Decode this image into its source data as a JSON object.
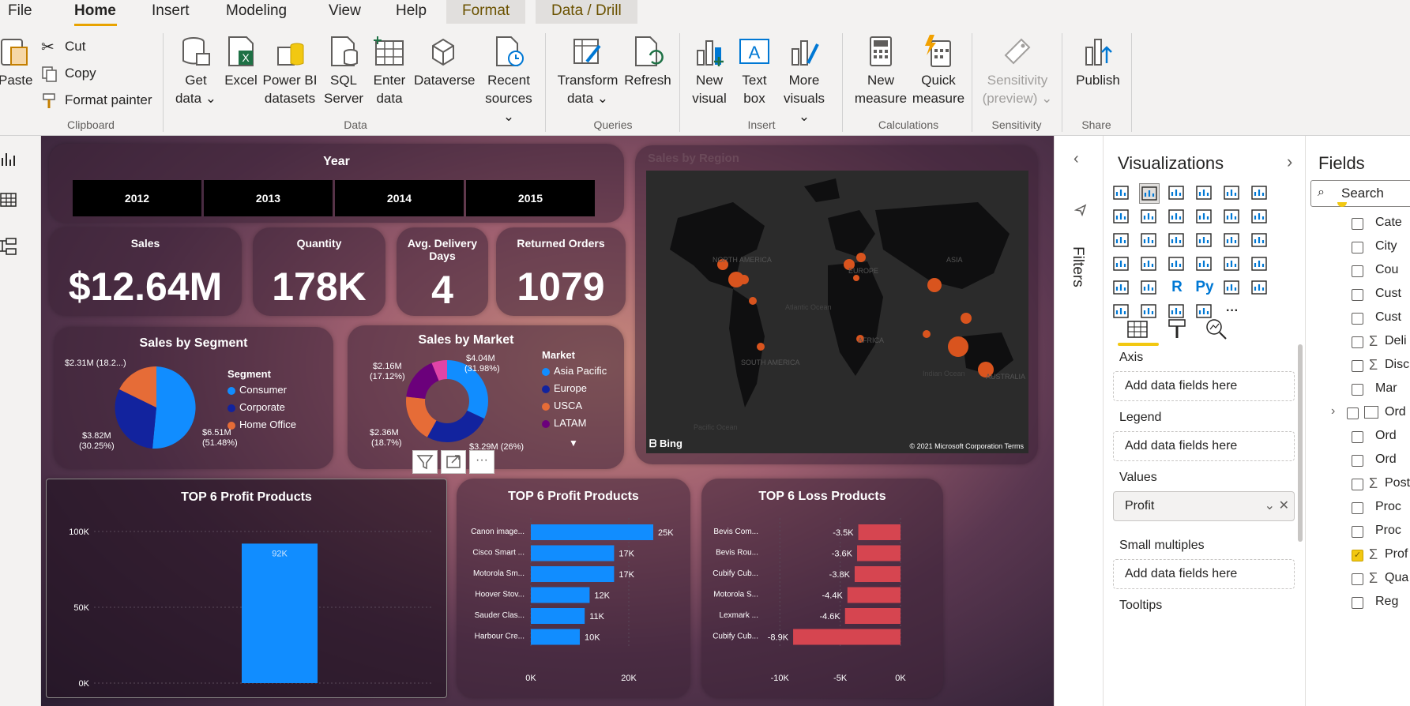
{
  "menu": {
    "file": "File",
    "home": "Home",
    "insert": "Insert",
    "modeling": "Modeling",
    "view": "View",
    "help": "Help",
    "format": "Format",
    "data_drill": "Data / Drill"
  },
  "ribbon": {
    "paste": "Paste",
    "cut": "Cut",
    "copy": "Copy",
    "format_painter": "Format painter",
    "clipboard": "Clipboard",
    "get_data_1": "Get",
    "get_data_2": "data ⌄",
    "excel": "Excel",
    "pbi_1": "Power BI",
    "pbi_2": "datasets",
    "sql_1": "SQL",
    "sql_2": "Server",
    "enter_1": "Enter",
    "enter_2": "data",
    "dataverse": "Dataverse",
    "recent_1": "Recent",
    "recent_2": "sources ⌄",
    "data_group": "Data",
    "transform_1": "Transform",
    "transform_2": "data ⌄",
    "refresh": "Refresh",
    "queries": "Queries",
    "new_visual_1": "New",
    "new_visual_2": "visual",
    "text_box_1": "Text",
    "text_box_2": "box",
    "more_visuals_1": "More",
    "more_visuals_2": "visuals ⌄",
    "insert_group": "Insert",
    "new_measure_1": "New",
    "new_measure_2": "measure",
    "quick_measure_1": "Quick",
    "quick_measure_2": "measure",
    "calculations": "Calculations",
    "sensitivity_1": "Sensitivity",
    "sensitivity_2": "(preview) ⌄",
    "sensitivity_group": "Sensitivity",
    "publish": "Publish",
    "share": "Share"
  },
  "dashboard": {
    "year_title": "Year",
    "years": [
      "2012",
      "2013",
      "2014",
      "2015"
    ],
    "kpis": {
      "sales_label": "Sales",
      "sales_value": "$12.64M",
      "quantity_label": "Quantity",
      "quantity_value": "178K",
      "delivery_label_1": "Avg. Delivery",
      "delivery_label_2": "Days",
      "delivery_value": "4",
      "returned_label": "Returned Orders",
      "returned_value": "1079"
    },
    "map": {
      "title": "Sales by Region",
      "bing": "Bing",
      "copyright": "© 2021 Microsoft Corporation  Terms",
      "labels": [
        "NORTH AMERICA",
        "EUROPE",
        "ASIA",
        "AFRICA",
        "SOUTH AMERICA",
        "AUSTRALIA",
        "Atlantic Ocean",
        "Indian Ocean",
        "Pacific Ocean"
      ]
    },
    "segment": {
      "title": "Sales by Segment",
      "legend_title": "Segment",
      "items": [
        {
          "name": "Consumer",
          "color": "#118dff"
        },
        {
          "name": "Corporate",
          "color": "#12239e"
        },
        {
          "name": "Home Office",
          "color": "#e66c37"
        }
      ],
      "label_top": "$2.31M (18.2...)",
      "label_left_1": "$3.82M",
      "label_left_2": "(30.25%)",
      "label_right_1": "$6.51M",
      "label_right_2": "(51.48%)"
    },
    "market": {
      "title": "Sales by Market",
      "legend_title": "Market",
      "items": [
        {
          "name": "Asia Pacific",
          "color": "#118dff"
        },
        {
          "name": "Europe",
          "color": "#12239e"
        },
        {
          "name": "USCA",
          "color": "#e66c37"
        },
        {
          "name": "LATAM",
          "color": "#6b007b"
        }
      ],
      "label_tl_1": "$2.16M",
      "label_tl_2": "(17.12%)",
      "label_tr_1": "$4.04M",
      "label_tr_2": "(31.98%)",
      "label_bl_1": "$2.36M",
      "label_bl_2": "(18.7%)",
      "label_br": "$3.29M (26%)"
    }
  },
  "chart_data": [
    {
      "type": "bar",
      "title": "TOP 6 Profit Products",
      "categories": [
        ""
      ],
      "values": [
        92
      ],
      "value_labels": [
        "92K"
      ],
      "yticks": [
        "0K",
        "50K",
        "100K"
      ],
      "ylim": [
        0,
        100
      ]
    },
    {
      "type": "bar",
      "orientation": "horizontal",
      "title": "TOP 6 Profit Products",
      "categories": [
        "Canon image...",
        "Cisco Smart ...",
        "Motorola Sm...",
        "Hoover Stov...",
        "Sauder Clas...",
        "Harbour Cre..."
      ],
      "values": [
        25,
        17,
        17,
        12,
        11,
        10
      ],
      "value_labels": [
        "25K",
        "17K",
        "17K",
        "12K",
        "11K",
        "10K"
      ],
      "xticks": [
        "0K",
        "20K"
      ],
      "xlim": [
        0,
        30
      ]
    },
    {
      "type": "bar",
      "orientation": "horizontal",
      "title": "TOP 6 Loss Products",
      "categories": [
        "Bevis Com...",
        "Bevis Rou...",
        "Cubify Cub...",
        "Motorola S...",
        "Lexmark ...",
        "Cubify Cub..."
      ],
      "values": [
        -3.5,
        -3.6,
        -3.8,
        -4.4,
        -4.6,
        -8.9
      ],
      "value_labels": [
        "-3.5K",
        "-3.6K",
        "-3.8K",
        "-4.4K",
        "-4.6K",
        "-8.9K"
      ],
      "xticks": [
        "-10K",
        "-5K",
        "0K"
      ],
      "xlim": [
        -11,
        0
      ]
    }
  ],
  "visualizations": {
    "title": "Visualizations",
    "filters": "Filters",
    "wells": {
      "axis": "Axis",
      "legend": "Legend",
      "values": "Values",
      "small_multiples": "Small multiples",
      "tooltips": "Tooltips",
      "placeholder": "Add data fields here",
      "values_field": "Profit"
    },
    "r_icon": "R",
    "py_icon": "Py",
    "more": "···"
  },
  "fields": {
    "title": "Fields",
    "search_placeholder": "Search",
    "items": [
      {
        "name": "Cate",
        "sigma": false,
        "checked": false
      },
      {
        "name": "City",
        "sigma": false,
        "checked": false
      },
      {
        "name": "Cou",
        "sigma": false,
        "checked": false
      },
      {
        "name": "Cust",
        "sigma": false,
        "checked": false
      },
      {
        "name": "Cust",
        "sigma": false,
        "checked": false
      },
      {
        "name": "Deli",
        "sigma": true,
        "checked": false
      },
      {
        "name": "Disc",
        "sigma": true,
        "checked": false
      },
      {
        "name": "Mar",
        "sigma": false,
        "checked": false
      },
      {
        "name": "Ord",
        "sigma": false,
        "checked": false,
        "date": true
      },
      {
        "name": "Ord",
        "sigma": false,
        "checked": false
      },
      {
        "name": "Ord",
        "sigma": false,
        "checked": false
      },
      {
        "name": "Post",
        "sigma": true,
        "checked": false
      },
      {
        "name": "Proc",
        "sigma": false,
        "checked": false
      },
      {
        "name": "Proc",
        "sigma": false,
        "checked": false
      },
      {
        "name": "Prof",
        "sigma": true,
        "checked": true
      },
      {
        "name": "Qua",
        "sigma": true,
        "checked": false
      },
      {
        "name": "Reg",
        "sigma": false,
        "checked": false
      }
    ]
  }
}
